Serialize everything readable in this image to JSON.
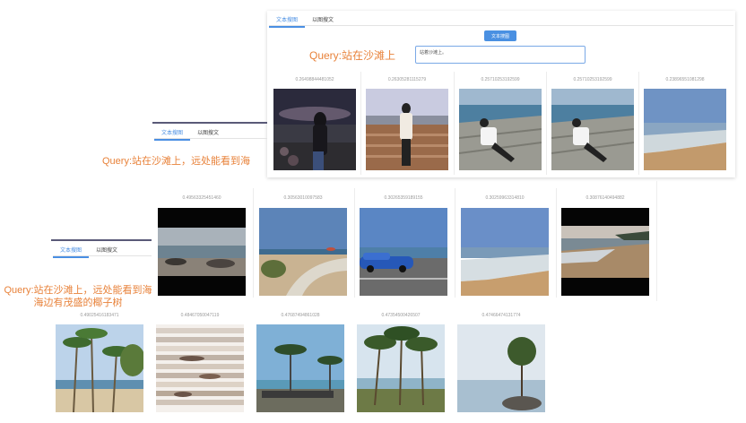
{
  "panel1": {
    "tabs": [
      "文本搜图",
      "以图搜文"
    ],
    "query": "Query:站在沙滩上",
    "button": "文本搜图",
    "input_value": "站着沙滩上。",
    "scores": [
      "0.26498844481052",
      "0.26305281115279",
      "0.25710253192599",
      "0.25710253192599",
      "0.23896551081298"
    ]
  },
  "panel2": {
    "tabs": [
      "文本搜图",
      "以图搜文"
    ],
    "query": "Query:站在沙滩上，远处能看到海",
    "scores": [
      "0.49563325451460",
      "0.30563010097583",
      "0.30265359189155",
      "0.30259963314810",
      "0.30876140494882"
    ]
  },
  "panel3": {
    "tabs": [
      "文本搜图",
      "以图搜文"
    ],
    "query_line1": "Query:站在沙滩上，远处能看到海",
    "query_line2": "海边有茂盛的椰子树",
    "scores": [
      "0.49025416183471",
      "0.48467050047119",
      "0.47687494861028",
      "0.47354500426507",
      "0.47466474131774"
    ]
  }
}
